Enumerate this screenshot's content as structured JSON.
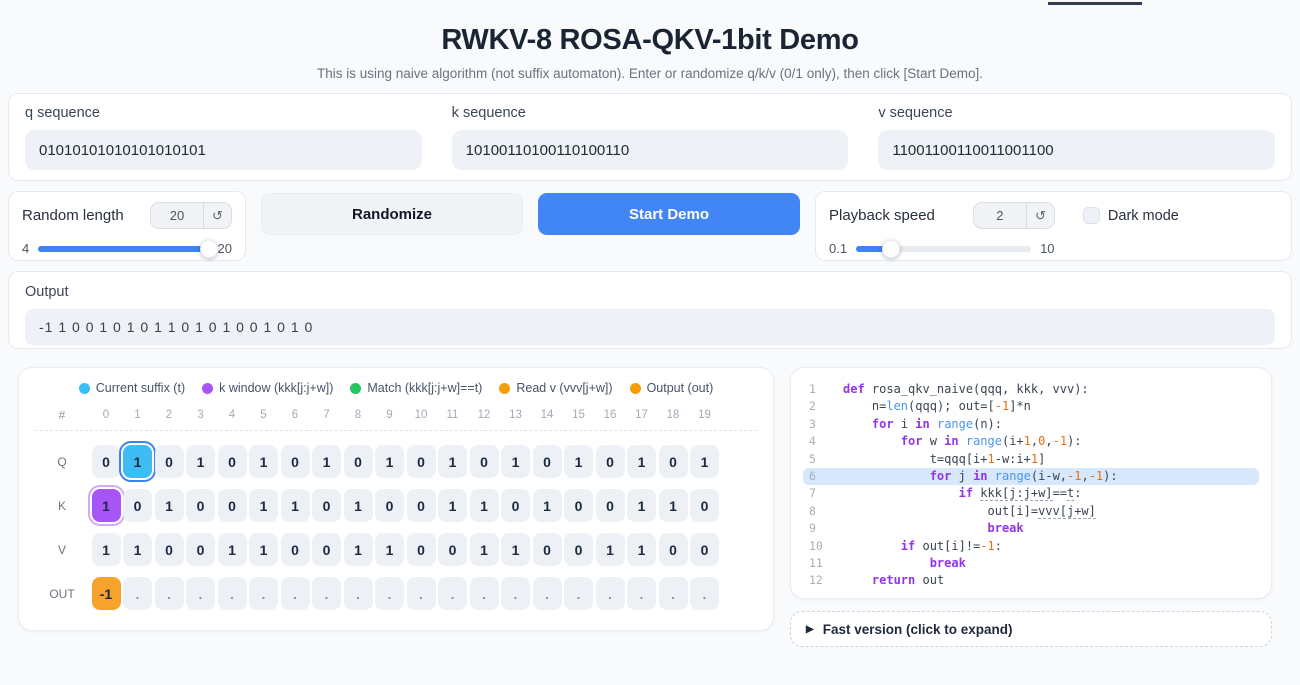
{
  "header": {
    "title": "RWKV-8 ROSA-QKV-1bit Demo",
    "subtitle": "This is using naive algorithm (not suffix automaton). Enter or randomize q/k/v (0/1 only), then click [Start Demo]."
  },
  "sequences": [
    {
      "label": "q sequence",
      "value": "01010101010101010101"
    },
    {
      "label": "k sequence",
      "value": "10100110100110100110"
    },
    {
      "label": "v sequence",
      "value": "11001100110011001100"
    }
  ],
  "controls": {
    "random_length": {
      "label": "Random length",
      "value": "20",
      "min": "4",
      "max": "20",
      "percent": 100,
      "reset_icon": "↺"
    },
    "randomize_label": "Randomize",
    "start_demo_label": "Start Demo",
    "playback_speed": {
      "label": "Playback speed",
      "value": "2",
      "min": "0.1",
      "max": "10",
      "percent": 20,
      "reset_icon": "↺"
    },
    "dark_mode_label": "Dark mode",
    "dark_mode_checked": false
  },
  "output": {
    "label": "Output",
    "value": "-1 1 0 0 1 0 1 0 1 1 0 1 0 1 0 0 1 0 1 0"
  },
  "visualization": {
    "legend": [
      {
        "label": "Current suffix (t)",
        "color": "#38bdf8"
      },
      {
        "label": "k window (kkk[j:j+w])",
        "color": "#a855f7"
      },
      {
        "label": "Match (kkk[j:j+w]==t)",
        "color": "#22c55e"
      },
      {
        "label": "Read v (vvv[j+w])",
        "color": "#f59e0b"
      },
      {
        "label": "Output (out)",
        "color": "#f59e0b"
      }
    ],
    "index_header": "#",
    "columns": [
      "0",
      "1",
      "2",
      "3",
      "4",
      "5",
      "6",
      "7",
      "8",
      "9",
      "10",
      "11",
      "12",
      "13",
      "14",
      "15",
      "16",
      "17",
      "18",
      "19"
    ],
    "rows": [
      {
        "label": "Q",
        "cells": [
          "0",
          "1",
          "0",
          "1",
          "0",
          "1",
          "0",
          "1",
          "0",
          "1",
          "0",
          "1",
          "0",
          "1",
          "0",
          "1",
          "0",
          "1",
          "0",
          "1"
        ],
        "highlights": {
          "1": "hl-suffix"
        }
      },
      {
        "label": "K",
        "cells": [
          "1",
          "0",
          "1",
          "0",
          "0",
          "1",
          "1",
          "0",
          "1",
          "0",
          "0",
          "1",
          "1",
          "0",
          "1",
          "0",
          "0",
          "1",
          "1",
          "0"
        ],
        "highlights": {
          "0": "hl-window"
        }
      },
      {
        "label": "V",
        "cells": [
          "1",
          "1",
          "0",
          "0",
          "1",
          "1",
          "0",
          "0",
          "1",
          "1",
          "0",
          "0",
          "1",
          "1",
          "0",
          "0",
          "1",
          "1",
          "0",
          "0"
        ],
        "highlights": {}
      },
      {
        "label": "OUT",
        "cells": [
          "-1",
          ".",
          ".",
          ".",
          ".",
          ".",
          ".",
          ".",
          ".",
          ".",
          ".",
          ".",
          ".",
          ".",
          ".",
          ".",
          ".",
          ".",
          ".",
          "."
        ],
        "highlights": {
          "0": "hl-output"
        }
      }
    ]
  },
  "code_panel": {
    "lines": [
      {
        "num": "1",
        "hl": false,
        "seg": [
          [
            "k",
            "def"
          ],
          [
            "p",
            " rosa_qkv_naive(qqq, kkk, vvv):"
          ]
        ]
      },
      {
        "num": "2",
        "hl": false,
        "seg": [
          [
            "p",
            "    n="
          ],
          [
            "f",
            "len"
          ],
          [
            "p",
            "(qqq); out=["
          ],
          [
            "n",
            "-1"
          ],
          [
            "p",
            "]*n"
          ]
        ]
      },
      {
        "num": "3",
        "hl": false,
        "seg": [
          [
            "p",
            "    "
          ],
          [
            "k",
            "for"
          ],
          [
            "p",
            " i "
          ],
          [
            "k",
            "in"
          ],
          [
            "p",
            " "
          ],
          [
            "f",
            "range"
          ],
          [
            "p",
            "(n):"
          ]
        ]
      },
      {
        "num": "4",
        "hl": false,
        "seg": [
          [
            "p",
            "        "
          ],
          [
            "k",
            "for"
          ],
          [
            "p",
            " w "
          ],
          [
            "k",
            "in"
          ],
          [
            "p",
            " "
          ],
          [
            "f",
            "range"
          ],
          [
            "p",
            "(i+"
          ],
          [
            "n",
            "1"
          ],
          [
            "p",
            ","
          ],
          [
            "n",
            "0"
          ],
          [
            "p",
            ","
          ],
          [
            "n",
            "-1"
          ],
          [
            "p",
            "):"
          ]
        ]
      },
      {
        "num": "5",
        "hl": false,
        "seg": [
          [
            "p",
            "            t=qqq[i+"
          ],
          [
            "n",
            "1"
          ],
          [
            "p",
            "-w:i+"
          ],
          [
            "n",
            "1"
          ],
          [
            "p",
            "]"
          ]
        ]
      },
      {
        "num": "6",
        "hl": true,
        "seg": [
          [
            "p",
            "            "
          ],
          [
            "k",
            "for"
          ],
          [
            "p",
            " j "
          ],
          [
            "k",
            "in"
          ],
          [
            "p",
            " "
          ],
          [
            "f",
            "range"
          ],
          [
            "p",
            "(i-w,"
          ],
          [
            "n",
            "-1"
          ],
          [
            "p",
            ","
          ],
          [
            "n",
            "-1"
          ],
          [
            "p",
            "):"
          ]
        ]
      },
      {
        "num": "7",
        "hl": false,
        "seg": [
          [
            "p",
            "                "
          ],
          [
            "k",
            "if"
          ],
          [
            "p",
            " "
          ],
          [
            "u",
            "kkk[j:j+w]"
          ],
          [
            "p",
            "=="
          ],
          [
            "u",
            "t"
          ],
          [
            "p",
            ":"
          ]
        ]
      },
      {
        "num": "8",
        "hl": false,
        "seg": [
          [
            "p",
            "                    out[i]="
          ],
          [
            "u",
            "vvv[j+w]"
          ]
        ]
      },
      {
        "num": "9",
        "hl": false,
        "seg": [
          [
            "p",
            "                    "
          ],
          [
            "k",
            "break"
          ]
        ]
      },
      {
        "num": "10",
        "hl": false,
        "seg": [
          [
            "p",
            "        "
          ],
          [
            "k",
            "if"
          ],
          [
            "p",
            " out[i]!="
          ],
          [
            "n",
            "-1"
          ],
          [
            "p",
            ":"
          ]
        ]
      },
      {
        "num": "11",
        "hl": false,
        "seg": [
          [
            "p",
            "            "
          ],
          [
            "k",
            "break"
          ]
        ]
      },
      {
        "num": "12",
        "hl": false,
        "seg": [
          [
            "p",
            "    "
          ],
          [
            "k",
            "return"
          ],
          [
            "p",
            " out"
          ]
        ]
      }
    ],
    "expander": {
      "icon": "▶",
      "label": "Fast version (click to expand)"
    }
  }
}
